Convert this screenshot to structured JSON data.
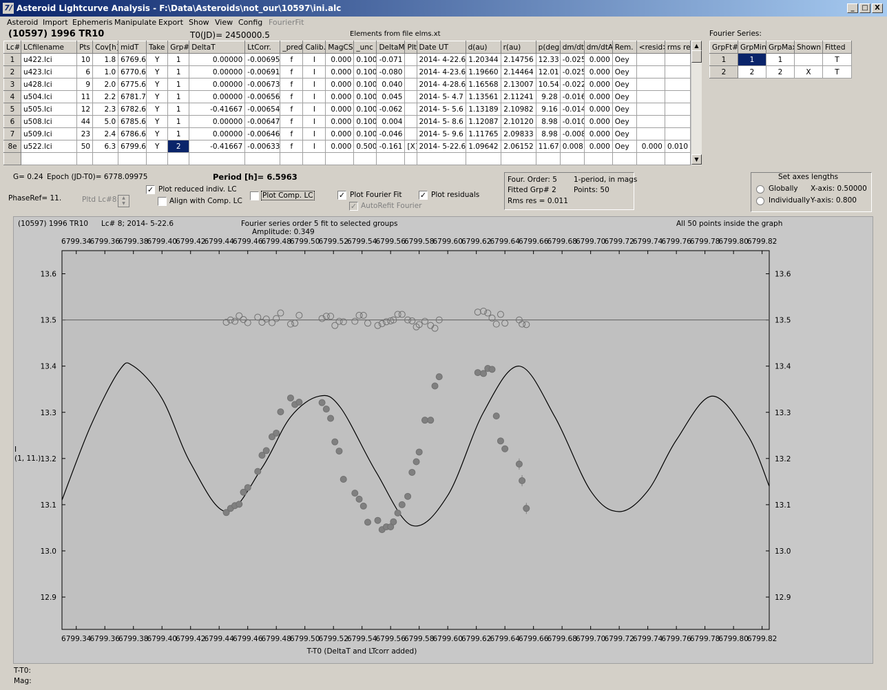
{
  "window": {
    "title": "Asteroid Lightcurve Analysis - F:\\Data\\Asteroids\\not_our\\10597\\ini.alc",
    "app_icon_glyph": "7/",
    "min_glyph": "_",
    "max_glyph": "□",
    "close_glyph": "X"
  },
  "menu": [
    "Asteroid",
    "Import",
    "Ephemeris",
    "Manipulate",
    "Export",
    "Show",
    "View",
    "Config",
    "FourierFit"
  ],
  "header": {
    "asteroid": "(10597) 1996 TR10",
    "t0": "T0(JD)= 2450000.5",
    "elements": "Elements from file elms.xt"
  },
  "lc_table": {
    "columns": [
      "Lc#",
      "LCfilename",
      "Pts",
      "Cov[h]",
      "midT",
      "Take",
      "Grp#",
      "DeltaT",
      "LtCorr.",
      "_pred.",
      "Calib.",
      "MagCS",
      "_unc",
      "DeltaM",
      "Plt",
      "Date UT",
      "d(au)",
      "r(au)",
      "p(deg)",
      "dm/dt",
      "dm/dtA",
      "Rem.",
      "<resid>",
      "rms res"
    ],
    "rows": [
      [
        "1",
        "u422.lci",
        "10",
        "1.8",
        "6769.6",
        "Y",
        "1",
        "0.00000",
        "-0.00695",
        "f",
        "I",
        "0.000",
        "0.100",
        "-0.071",
        "",
        "2014- 4-22.6",
        "1.20344",
        "2.14756",
        "12.33",
        "-0.025",
        "0.000",
        "Oey",
        "",
        ""
      ],
      [
        "2",
        "u423.lci",
        "6",
        "1.0",
        "6770.6",
        "Y",
        "1",
        "0.00000",
        "-0.00691",
        "f",
        "I",
        "0.000",
        "0.100",
        "-0.080",
        "",
        "2014- 4-23.6",
        "1.19660",
        "2.14464",
        "12.01",
        "-0.025",
        "0.000",
        "Oey",
        "",
        ""
      ],
      [
        "3",
        "u428.lci",
        "9",
        "2.0",
        "6775.6",
        "Y",
        "1",
        "0.00000",
        "-0.00673",
        "f",
        "I",
        "0.000",
        "0.100",
        "0.040",
        "",
        "2014- 4-28.6",
        "1.16568",
        "2.13007",
        "10.54",
        "-0.022",
        "0.000",
        "Oey",
        "",
        ""
      ],
      [
        "4",
        "u504.lci",
        "11",
        "2.2",
        "6781.7",
        "Y",
        "1",
        "0.00000",
        "-0.00656",
        "f",
        "I",
        "0.000",
        "0.100",
        "0.045",
        "",
        "2014- 5- 4.7",
        "1.13561",
        "2.11241",
        "9.28",
        "-0.016",
        "0.000",
        "Oey",
        "",
        ""
      ],
      [
        "5",
        "u505.lci",
        "12",
        "2.3",
        "6782.6",
        "Y",
        "1",
        "-0.41667",
        "-0.00654",
        "f",
        "I",
        "0.000",
        "0.100",
        "-0.062",
        "",
        "2014- 5- 5.6",
        "1.13189",
        "2.10982",
        "9.16",
        "-0.014",
        "0.000",
        "Oey",
        "",
        ""
      ],
      [
        "6",
        "u508.lci",
        "44",
        "5.0",
        "6785.6",
        "Y",
        "1",
        "0.00000",
        "-0.00647",
        "f",
        "I",
        "0.000",
        "0.100",
        "0.004",
        "",
        "2014- 5- 8.6",
        "1.12087",
        "2.10120",
        "8.98",
        "-0.010",
        "0.000",
        "Oey",
        "",
        ""
      ],
      [
        "7",
        "u509.lci",
        "23",
        "2.4",
        "6786.6",
        "Y",
        "1",
        "0.00000",
        "-0.00646",
        "f",
        "I",
        "0.000",
        "0.100",
        "-0.046",
        "",
        "2014- 5- 9.6",
        "1.11765",
        "2.09833",
        "8.98",
        "-0.008",
        "0.000",
        "Oey",
        "",
        ""
      ],
      [
        "8e",
        "u522.lci",
        "50",
        "6.3",
        "6799.6",
        "Y",
        "2",
        "-0.41667",
        "-0.00633",
        "f",
        "I",
        "0.000",
        "0.500",
        "-0.161",
        "[X]",
        "2014- 5-22.6",
        "1.09642",
        "2.06152",
        "11.67",
        "0.008",
        "0.000",
        "Oey",
        "0.000",
        "0.010"
      ]
    ]
  },
  "fourier_table": {
    "title": "Fourier Series:",
    "columns": [
      "GrpFt#",
      "GrpMin",
      "GrpMax",
      "Shown",
      "Fitted"
    ],
    "rows": [
      [
        "1",
        "1",
        "1",
        "",
        "T"
      ],
      [
        "2",
        "2",
        "2",
        "X",
        "T"
      ]
    ]
  },
  "controls": {
    "g": "G= 0.24",
    "epoch": "Epoch (JD-T0)= 6778.09975",
    "period": "Period [h]= 6.5963",
    "phaseref": "PhaseRef= 11.",
    "pltd_lc": "Pltd Lc#8:",
    "plot_reduced": "Plot reduced indiv. LC",
    "align_comp": "Align with Comp. LC",
    "plot_comp": "Plot Comp. LC",
    "plot_fourier": "Plot Fourier Fit",
    "autorefit": "AutoRefit Fourier",
    "plot_residuals": "Plot residuals",
    "check_glyph": "✓"
  },
  "info_box": {
    "four_order": "Four. Order:  5",
    "one_period": "1-period, in mags",
    "fitted_grp": "Fitted Grp# 2",
    "points": "Points: 50",
    "rms": "Rms res      = 0.011"
  },
  "axes_box": {
    "title": "Set axes lengths",
    "globally": "Globally",
    "individually": "Individually",
    "xaxis": "X-axis:   0.50000",
    "yaxis": "Y-axis:    0.800"
  },
  "plot_header": {
    "asteroid": "(10597) 1996 TR10",
    "lc": "Lc# 8; 2014- 5-22.6",
    "fourier": "Fourier series order 5 fit to selected groups",
    "amplitude": "Amplitude: 0.349",
    "points_inside": "All 50 points inside the graph"
  },
  "ylabel": "I\n(1, 11.)",
  "footer": {
    "t_t0": "T-T0:",
    "mag": "Mag:"
  },
  "chart_data": {
    "type": "scatter",
    "xlabel": "T-T0 (DeltaT and LTcorr added)",
    "ylabel": "I",
    "xlim": [
      6799.33,
      6799.825
    ],
    "ylim": [
      13.65,
      12.83
    ],
    "inverted_y": true,
    "grid": false,
    "x_ticks": [
      "6799.34",
      "6799.36",
      "6799.38",
      "6799.40",
      "6799.42",
      "6799.44",
      "6799.46",
      "6799.48",
      "6799.50",
      "6799.52",
      "6799.54",
      "6799.56",
      "6799.58",
      "6799.60",
      "6799.62",
      "6799.64",
      "6799.66",
      "6799.68",
      "6799.70",
      "6799.72",
      "6799.74",
      "6799.76",
      "6799.78",
      "6799.80",
      "6799.82"
    ],
    "y_ticks": [
      "12.9",
      "13.0",
      "13.1",
      "13.2",
      "13.3",
      "13.4",
      "13.5",
      "13.6"
    ],
    "residual_baseline": 13.5,
    "fourier_curve": {
      "x": [
        6799.33,
        6799.35,
        6799.37,
        6799.38,
        6799.4,
        6799.42,
        6799.445,
        6799.47,
        6799.49,
        6799.51,
        6799.525,
        6799.55,
        6799.575,
        6799.6,
        6799.625,
        6799.65,
        6799.675,
        6799.7,
        6799.72,
        6799.74,
        6799.76,
        6799.785,
        6799.81,
        6799.825
      ],
      "y": [
        13.11,
        13.27,
        13.39,
        13.4,
        13.33,
        13.19,
        13.085,
        13.18,
        13.29,
        13.335,
        13.31,
        13.17,
        13.055,
        13.12,
        13.3,
        13.4,
        13.29,
        13.13,
        13.085,
        13.13,
        13.24,
        13.335,
        13.25,
        13.14
      ]
    },
    "points": {
      "x": [
        6799.445,
        6799.448,
        6799.451,
        6799.454,
        6799.457,
        6799.46,
        6799.467,
        6799.47,
        6799.473,
        6799.477,
        6799.48,
        6799.483,
        6799.49,
        6799.493,
        6799.496,
        6799.512,
        6799.515,
        6799.518,
        6799.521,
        6799.524,
        6799.527,
        6799.535,
        6799.538,
        6799.541,
        6799.544,
        6799.551,
        6799.554,
        6799.557,
        6799.56,
        6799.562,
        6799.565,
        6799.568,
        6799.572,
        6799.575,
        6799.578,
        6799.58,
        6799.584,
        6799.588,
        6799.591,
        6799.594,
        6799.621,
        6799.625,
        6799.628,
        6799.631,
        6799.634,
        6799.637,
        6799.64,
        6799.65,
        6799.652,
        6799.655
      ],
      "y": [
        13.083,
        13.092,
        13.098,
        13.101,
        13.127,
        13.137,
        13.172,
        13.207,
        13.217,
        13.247,
        13.255,
        13.301,
        13.331,
        13.317,
        13.322,
        13.321,
        13.307,
        13.287,
        13.236,
        13.216,
        13.155,
        13.125,
        13.112,
        13.097,
        13.062,
        13.066,
        13.046,
        13.052,
        13.052,
        13.063,
        13.082,
        13.1,
        13.118,
        13.17,
        13.193,
        13.214,
        13.283,
        13.283,
        13.357,
        13.377,
        13.386,
        13.384,
        13.395,
        13.393,
        13.292,
        13.238,
        13.221,
        13.188,
        13.152,
        13.092
      ]
    },
    "residuals": {
      "x": [
        6799.445,
        6799.448,
        6799.451,
        6799.454,
        6799.457,
        6799.46,
        6799.467,
        6799.47,
        6799.473,
        6799.477,
        6799.48,
        6799.483,
        6799.49,
        6799.493,
        6799.496,
        6799.512,
        6799.515,
        6799.518,
        6799.521,
        6799.524,
        6799.527,
        6799.535,
        6799.538,
        6799.541,
        6799.544,
        6799.551,
        6799.554,
        6799.557,
        6799.56,
        6799.562,
        6799.565,
        6799.568,
        6799.572,
        6799.575,
        6799.578,
        6799.58,
        6799.584,
        6799.588,
        6799.591,
        6799.594,
        6799.621,
        6799.625,
        6799.628,
        6799.631,
        6799.634,
        6799.637,
        6799.64,
        6799.65,
        6799.652,
        6799.655
      ],
      "y": [
        13.495,
        13.5,
        13.497,
        13.509,
        13.501,
        13.494,
        13.506,
        13.495,
        13.502,
        13.494,
        13.503,
        13.515,
        13.491,
        13.493,
        13.51,
        13.503,
        13.508,
        13.508,
        13.488,
        13.497,
        13.496,
        13.497,
        13.51,
        13.51,
        13.493,
        13.488,
        13.492,
        13.496,
        13.498,
        13.5,
        13.512,
        13.512,
        13.5,
        13.498,
        13.485,
        13.49,
        13.497,
        13.488,
        13.482,
        13.5,
        13.517,
        13.519,
        13.515,
        13.504,
        13.491,
        13.512,
        13.493,
        13.5,
        13.491,
        13.49
      ]
    }
  }
}
